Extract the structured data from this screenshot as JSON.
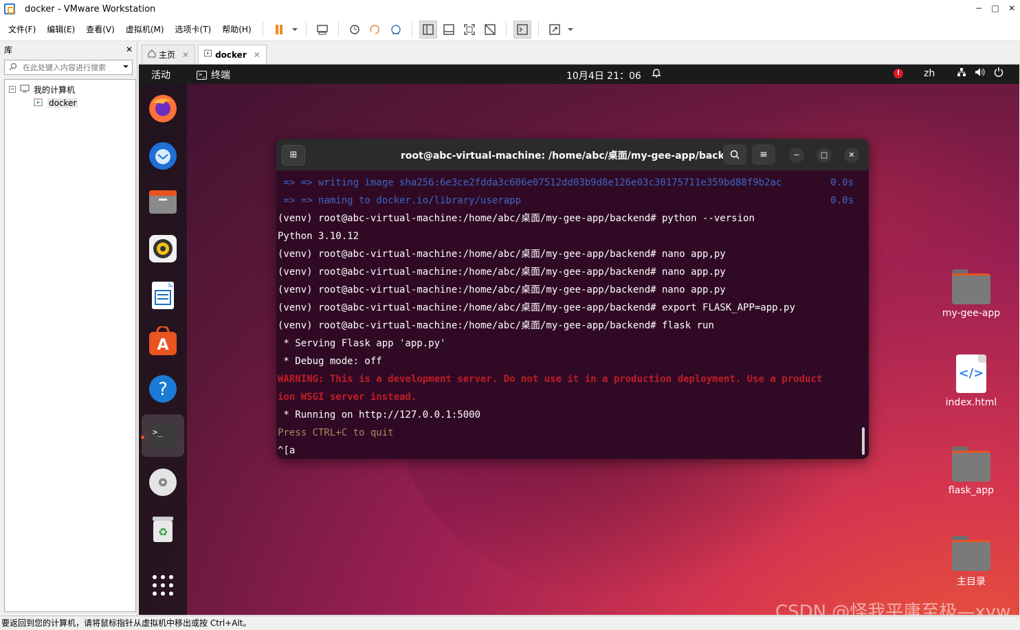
{
  "window": {
    "title": "docker - VMware Workstation",
    "controls": [
      "−",
      "□",
      "✕"
    ]
  },
  "menubar": {
    "items": [
      "文件(F)",
      "编辑(E)",
      "查看(V)",
      "虚拟机(M)",
      "选项卡(T)",
      "帮助(H)"
    ]
  },
  "library": {
    "title": "库",
    "close": "✕",
    "search_placeholder": "在此处键入内容进行搜索",
    "tree": {
      "root": "我的计算机",
      "children": [
        "docker"
      ]
    }
  },
  "tabs": [
    {
      "label": "主页",
      "close": "✕"
    },
    {
      "label": "docker",
      "close": "✕"
    }
  ],
  "ubuntu": {
    "activities": "活动",
    "app_name": "终端",
    "clock": "10月4日 21：06",
    "lang": "zh",
    "warn_badge": "!"
  },
  "desktop_icons": [
    {
      "label": "my-gee-app",
      "type": "folder"
    },
    {
      "label": "index.html",
      "type": "html"
    },
    {
      "label": "flask_app",
      "type": "folder"
    },
    {
      "label": "主目录",
      "type": "home"
    }
  ],
  "terminal": {
    "title": "root@abc-virtual-machine: /home/abc/桌面/my-gee-app/backend",
    "lines": [
      {
        "text": " => => writing image sha256:6e3ce2fdda3c606e07512dd03b9d8e126e03c30175711e359bd88f9b2ac",
        "right": "0.0s",
        "style": "dim"
      },
      {
        "text": " => => naming to docker.io/library/userapp",
        "right": "0.0s",
        "style": "dim"
      },
      {
        "text": "(venv) root@abc-virtual-machine:/home/abc/桌面/my-gee-app/backend# python --version",
        "right": "",
        "style": ""
      },
      {
        "text": "Python 3.10.12",
        "right": "",
        "style": ""
      },
      {
        "text": "(venv) root@abc-virtual-machine:/home/abc/桌面/my-gee-app/backend# nano app,py",
        "right": "",
        "style": ""
      },
      {
        "text": "(venv) root@abc-virtual-machine:/home/abc/桌面/my-gee-app/backend# nano app.py",
        "right": "",
        "style": ""
      },
      {
        "text": "(venv) root@abc-virtual-machine:/home/abc/桌面/my-gee-app/backend# nano app.py",
        "right": "",
        "style": ""
      },
      {
        "text": "(venv) root@abc-virtual-machine:/home/abc/桌面/my-gee-app/backend# export FLASK_APP=app.py",
        "right": "",
        "style": ""
      },
      {
        "text": "(venv) root@abc-virtual-machine:/home/abc/桌面/my-gee-app/backend# flask run",
        "right": "",
        "style": ""
      },
      {
        "text": " * Serving Flask app 'app.py'",
        "right": "",
        "style": ""
      },
      {
        "text": " * Debug mode: off",
        "right": "",
        "style": ""
      },
      {
        "text": "WARNING: This is a development server. Do not use it in a production deployment. Use a product",
        "right": "",
        "style": "warn"
      },
      {
        "text": "ion WSGI server instead.",
        "right": "",
        "style": "warn"
      },
      {
        "text": " * Running on http://127.0.0.1:5000",
        "right": "",
        "style": ""
      },
      {
        "text": "Press CTRL+C to quit",
        "right": "",
        "style": "quit"
      },
      {
        "text": "^[a",
        "right": "",
        "style": ""
      }
    ]
  },
  "watermark": "CSDN @怪我平庸至极—xyw",
  "statusbar": {
    "text": "要返回到您的计算机，请将鼠标指针从虚拟机中移出或按 Ctrl+Alt。"
  },
  "colors": {
    "terminal_bg": "#300a24",
    "accent": "#e95420",
    "warning": "#c01c28"
  }
}
